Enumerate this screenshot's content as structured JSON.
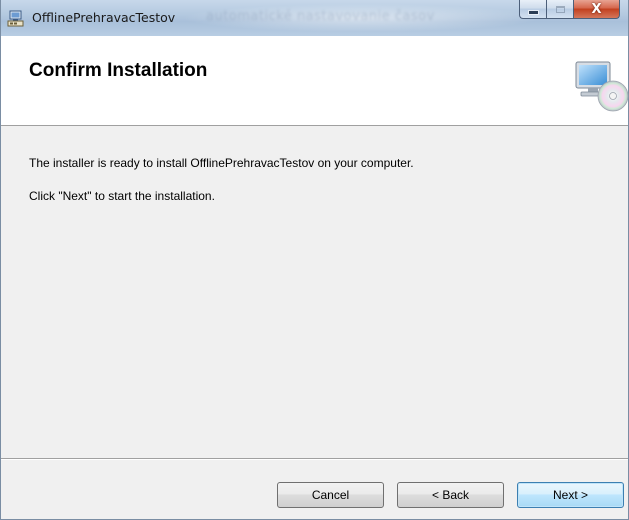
{
  "window": {
    "title": "OfflinePrehravacTestov",
    "background_title_text": "automatické nastavovanie časov"
  },
  "caption_buttons": {
    "minimize_icon": "minimize-icon",
    "maximize_icon": "maximize-icon",
    "close_label": "X"
  },
  "banner": {
    "title": "Confirm Installation",
    "icon": "computer-with-cd-icon"
  },
  "content": {
    "line1": "The installer is ready to install OfflinePrehravacTestov on your computer.",
    "line2": "Click \"Next\" to start the installation."
  },
  "buttons": {
    "cancel": "Cancel",
    "back": "< Back",
    "next": "Next >"
  },
  "colors": {
    "close_button": "#c2401f",
    "next_button_border": "#3c7fb1",
    "window_background": "#f0f0f0",
    "banner_background": "#ffffff"
  }
}
